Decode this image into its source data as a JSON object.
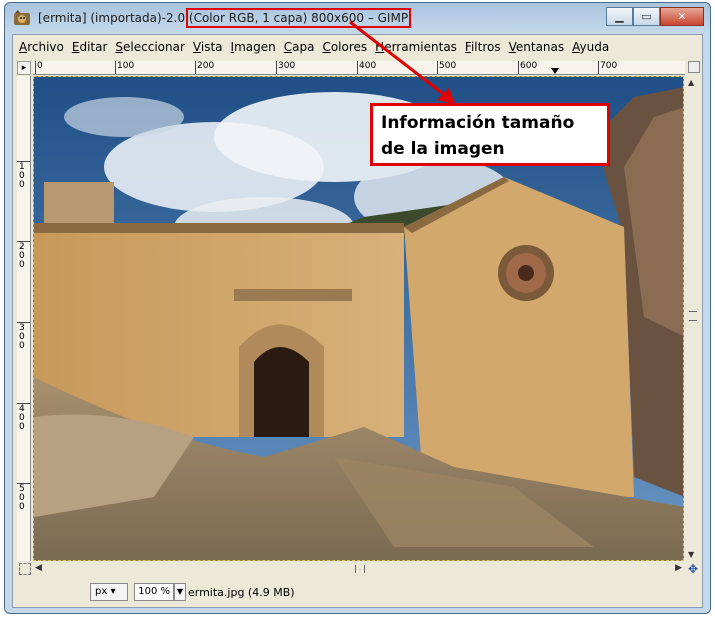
{
  "window": {
    "title_prefix": "[ermita] (importada)-2.0 ",
    "title_highlight": "(Color RGB, 1 capa) 800x600 – GIMP",
    "minimize_glyph": "▁",
    "maximize_glyph": "▭",
    "close_glyph": "✕"
  },
  "menubar": {
    "items": [
      "Archivo",
      "Editar",
      "Seleccionar",
      "Vista",
      "Imagen",
      "Capa",
      "Colores",
      "Herramientas",
      "Filtros",
      "Ventanas",
      "Ayuda"
    ]
  },
  "rulers": {
    "horizontal_labels": [
      "0",
      "100",
      "200",
      "300",
      "400",
      "500",
      "600",
      "700"
    ],
    "vertical_labels": [
      "100",
      "200",
      "300",
      "400",
      "500"
    ]
  },
  "canvas": {
    "image_description_icon": "photo-ermita"
  },
  "statusbar": {
    "unit": "px",
    "zoom": "100 %",
    "file_info": "ermita.jpg (4.9 MB)"
  },
  "annotation": {
    "line1": "Información tamaño",
    "line2": "de la imagen",
    "color": "#e00000"
  },
  "icons": {
    "app": "gimp-icon",
    "navigate": "navigate-icon",
    "quick_mask": "quick-mask-icon",
    "move": "move-icon"
  }
}
